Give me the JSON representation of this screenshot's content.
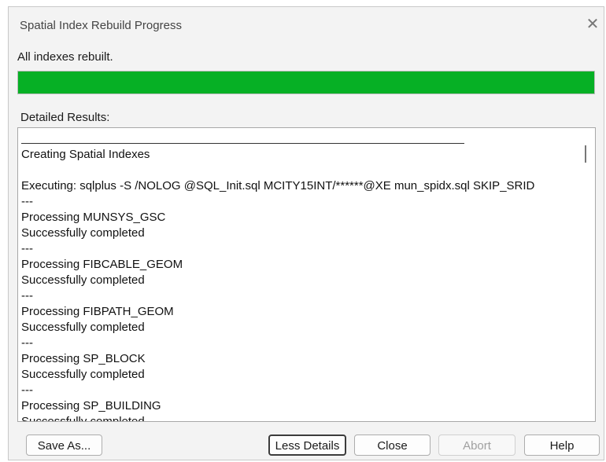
{
  "window": {
    "title": "Spatial Index Rebuild Progress",
    "close_glyph": "✕"
  },
  "status": {
    "text": "All indexes rebuilt.",
    "progress_fraction": 1.0,
    "progress_color": "#06b025"
  },
  "details": {
    "label": "Detailed Results:",
    "lines": [
      "Creating Spatial Indexes",
      "",
      "Executing: sqlplus -S /NOLOG @SQL_Init.sql MCITY15INT/******@XE mun_spidx.sql SKIP_SRID",
      "---",
      "Processing MUNSYS_GSC",
      "Successfully completed",
      "---",
      "Processing FIBCABLE_GEOM",
      "Successfully completed",
      "---",
      "Processing FIBPATH_GEOM",
      "Successfully completed",
      "---",
      "Processing SP_BLOCK",
      "Successfully completed",
      "---",
      "Processing SP_BUILDING",
      "Successfully completed"
    ]
  },
  "buttons": {
    "save_as": "Save As...",
    "less_details": "Less Details",
    "close": "Close",
    "abort": "Abort",
    "help": "Help"
  }
}
